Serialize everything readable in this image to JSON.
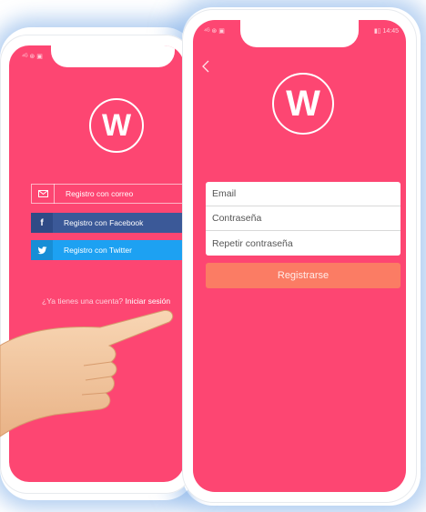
{
  "back_phone": {
    "status_left": "⁴ᴳ ⊛ ▣",
    "logo_letter": "W",
    "buttons": [
      {
        "label": "Registro con correo",
        "icon": "mail-icon"
      },
      {
        "label": "Registro con Facebook",
        "icon": "facebook-icon"
      },
      {
        "label": "Registro con Twitter",
        "icon": "twitter-icon"
      }
    ],
    "login_prompt": "¿Ya tienes una cuenta?",
    "login_link": "Iniciar sesión"
  },
  "front_phone": {
    "status_left": "⁴ᴳ ⊛ ▣",
    "status_right": "▮▯ 14:45",
    "back_icon": "chevron-left-icon",
    "logo_letter": "W",
    "fields": [
      {
        "label": "Email"
      },
      {
        "label": "Contraseña"
      },
      {
        "label": "Repetir contraseña"
      }
    ],
    "submit_label": "Registrarse"
  },
  "colors": {
    "screen": "#fd4672",
    "facebook": "#3b5998",
    "twitter": "#1da1f2",
    "register_button": "#fb7c64"
  }
}
